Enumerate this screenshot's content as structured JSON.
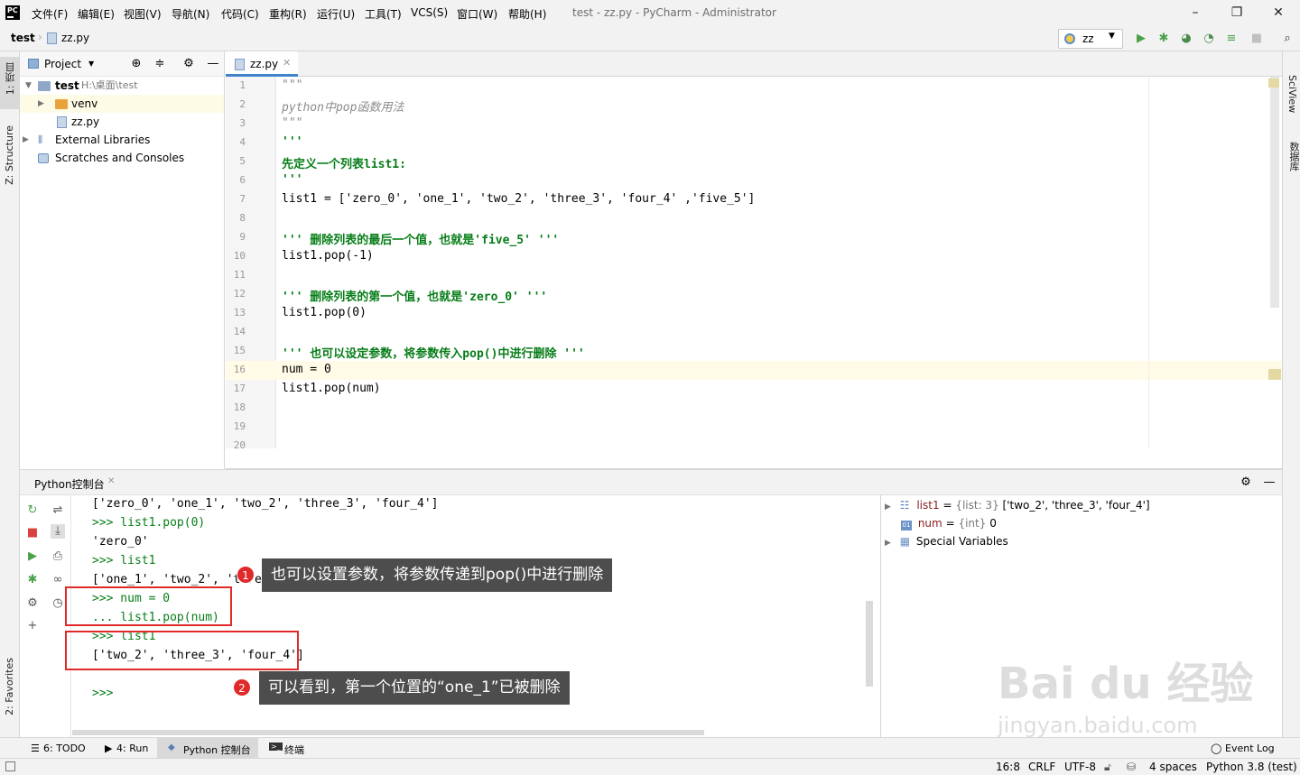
{
  "menubar": {
    "items": [
      "文件(F)",
      "编辑(E)",
      "视图(V)",
      "导航(N)",
      "代码(C)",
      "重构(R)",
      "运行(U)",
      "工具(T)",
      "VCS(S)",
      "窗口(W)",
      "帮助(H)"
    ],
    "window_title": "test - zz.py - PyCharm - Administrator",
    "logo_text": "PC"
  },
  "navbar": {
    "breadcrumb_project": "test",
    "breadcrumb_file": "zz.py",
    "run_config": "zz"
  },
  "left_strip": {
    "project_tab": "1: 项目",
    "structure_tab": "Z: Structure",
    "favorites_tab": "2: Favorites"
  },
  "right_strip": {
    "sciview": "SciView",
    "database": "数据库"
  },
  "project": {
    "header": "Project",
    "tree": [
      {
        "name": "test",
        "path": "H:\\桌面\\test"
      },
      {
        "name": "venv"
      },
      {
        "name": "zz.py"
      },
      {
        "name": "External Libraries"
      },
      {
        "name": "Scratches and Consoles"
      }
    ]
  },
  "editor": {
    "tab": "zz.py",
    "line_numbers": [
      "1",
      "2",
      "3",
      "4",
      "5",
      "6",
      "7",
      "8",
      "9",
      "10",
      "11",
      "12",
      "13",
      "14",
      "15",
      "16",
      "17",
      "18",
      "19",
      "20"
    ],
    "lines": [
      "\"\"\"",
      "python中pop函数用法",
      "\"\"\"",
      "'''",
      "先定义一个列表list1:",
      "'''",
      "list1 = ['zero_0', 'one_1', 'two_2', 'three_3', 'four_4' ,'five_5']",
      "",
      "''' 删除列表的最后一个值，也就是'five_5' '''",
      "list1.pop(-1)",
      "",
      "''' 删除列表的第一个值，也就是'zero_0' '''",
      "list1.pop(0)",
      "",
      "''' 也可以设定参数，将参数传入pop()中进行删除 '''",
      "num = 0",
      "list1.pop(num)",
      "",
      "",
      ""
    ]
  },
  "console": {
    "tab": "Python控制台",
    "lines": [
      "['zero_0', 'one_1', 'two_2', 'three_3', 'four_4']",
      ">>> list1.pop(0)",
      "'zero_0'",
      ">>> list1",
      "['one_1', 'two_2', 'three_3', 'four_4']",
      ">>> num = 0",
      "... list1.pop(num)",
      ">>> list1",
      "['two_2', 'three_3', 'four_4']",
      "",
      ">>>"
    ],
    "variables": [
      {
        "name": "list1",
        "type": "{list: 3}",
        "value": "['two_2', 'three_3', 'four_4']"
      },
      {
        "name": "num",
        "type": "{int}",
        "value": "0"
      },
      {
        "name": "Special Variables",
        "type": "",
        "value": ""
      }
    ]
  },
  "annotations": {
    "callout1_num": "1",
    "callout1_text": "也可以设置参数，将参数传递到pop()中进行删除",
    "callout2_num": "2",
    "callout2_text": "可以看到，第一个位置的“one_1”已被删除"
  },
  "bottom_tabs": [
    "6: TODO",
    "4: Run",
    "Python 控制台",
    "终端"
  ],
  "event_log": "Event Log",
  "status": {
    "position": "16:8",
    "line_sep": "CRLF",
    "encoding": "UTF-8",
    "indent": "4 spaces",
    "interpreter": "Python 3.8 (test)"
  },
  "watermark": {
    "brand": "Bai du 经验",
    "url": "jingyan.baidu.com"
  },
  "colors": {
    "keyword_green": "#067d17",
    "number_blue": "#1750eb",
    "comment_gray": "#8c8c8c",
    "annotation_red": "#e02a2a",
    "callout_bg": "#4d4d4d"
  }
}
